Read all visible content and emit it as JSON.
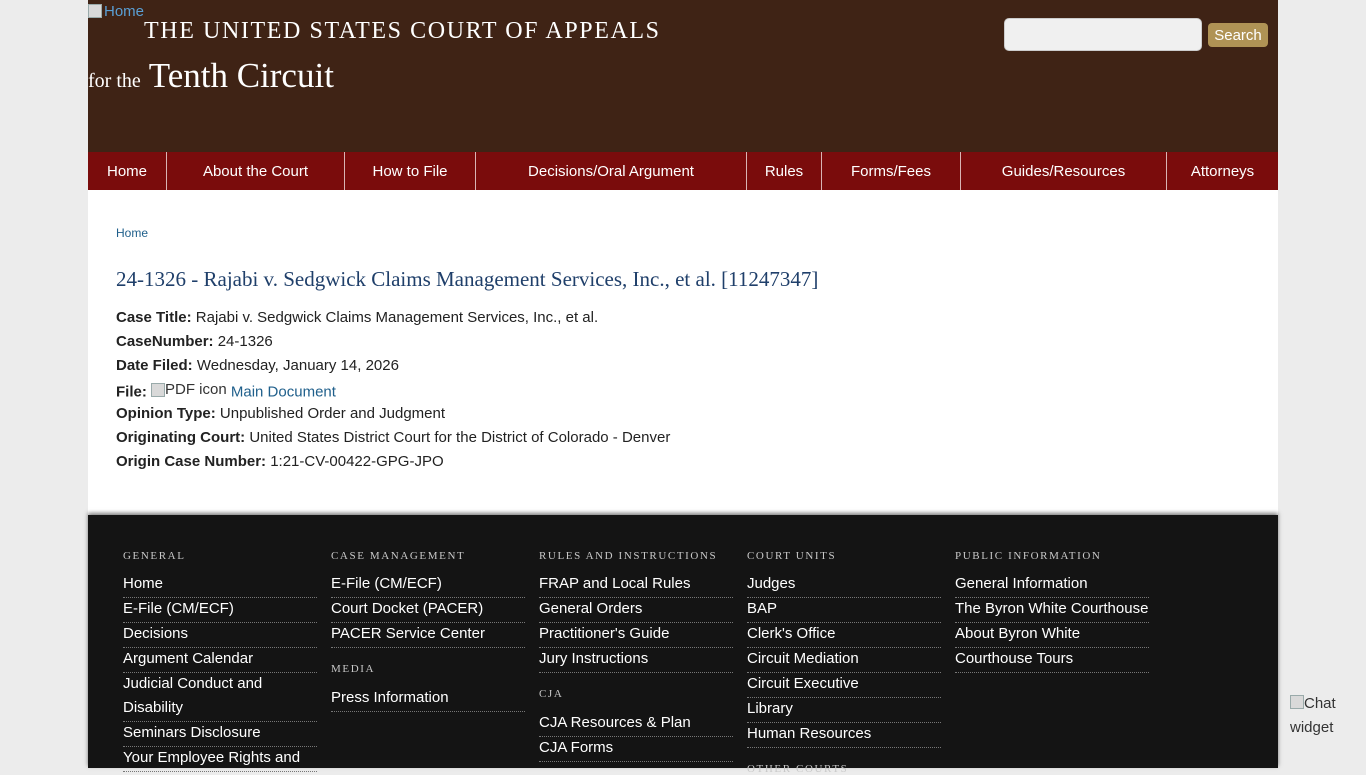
{
  "header": {
    "home_alt": "Home",
    "title_line1": "THE UNITED STATES COURT OF APPEALS",
    "title_for_the": "for the",
    "title_circuit": "Tenth Circuit",
    "search_placeholder": "",
    "search_button": "Search"
  },
  "nav": [
    "Home",
    "About the Court",
    "How to File",
    "Decisions/Oral Argument",
    "Rules",
    "Forms/Fees",
    "Guides/Resources",
    "Attorneys"
  ],
  "breadcrumb": "Home",
  "case": {
    "heading": "24-1326 - Rajabi v. Sedgwick Claims Management Services, Inc., et al. [11247347]",
    "title_label": "Case Title:",
    "title_value": "Rajabi v. Sedgwick Claims Management Services, Inc., et al.",
    "number_label": "CaseNumber:",
    "number_value": "24-1326",
    "date_label": "Date Filed:",
    "date_value": "Wednesday, January 14, 2026",
    "file_label": "File:",
    "file_icon_alt": "PDF icon",
    "file_link": "Main Document",
    "opinion_label": "Opinion Type:",
    "opinion_value": "Unpublished Order and Judgment",
    "court_label": "Originating Court:",
    "court_value": "United States District Court for the District of Colorado - Denver",
    "origin_label": "Origin Case Number:",
    "origin_value": "1:21-CV-00422-GPG-JPO"
  },
  "footer": {
    "general": {
      "heading": "GENERAL",
      "links": [
        "Home",
        "E-File (CM/ECF)",
        "Decisions",
        "Argument Calendar",
        "Judicial Conduct and Disability",
        "Seminars Disclosure",
        "Your Employee Rights and"
      ]
    },
    "case_management": {
      "heading": "CASE MANAGEMENT",
      "links": [
        "E-File (CM/ECF)",
        "Court Docket (PACER)",
        "PACER Service Center"
      ]
    },
    "media": {
      "heading": "MEDIA",
      "links": [
        "Press Information"
      ]
    },
    "rules": {
      "heading": "RULES AND INSTRUCTIONS",
      "links": [
        "FRAP and Local Rules",
        "General Orders",
        "Practitioner's Guide",
        "Jury Instructions"
      ]
    },
    "cja": {
      "heading": "CJA",
      "links": [
        "CJA Resources & Plan",
        "CJA Forms"
      ]
    },
    "court_units": {
      "heading": "COURT UNITS",
      "links": [
        "Judges",
        "BAP",
        "Clerk's Office",
        "Circuit Mediation",
        "Circuit Executive",
        "Library",
        "Human Resources"
      ]
    },
    "other_courts": {
      "heading": "OTHER COURTS"
    },
    "public": {
      "heading": "PUBLIC INFORMATION",
      "links": [
        "General Information",
        "The Byron White Courthouse",
        "About Byron White",
        "Courthouse Tours"
      ]
    }
  },
  "chat_widget_alt": "Chat widget",
  "colors": {
    "header_bg": "#3f2315",
    "nav_bg": "#7a0c0c",
    "footer_bg": "#141414",
    "search_button_bg": "#b09355",
    "heading_blue": "#1f3f6a",
    "link_blue": "#1f5f8b"
  }
}
